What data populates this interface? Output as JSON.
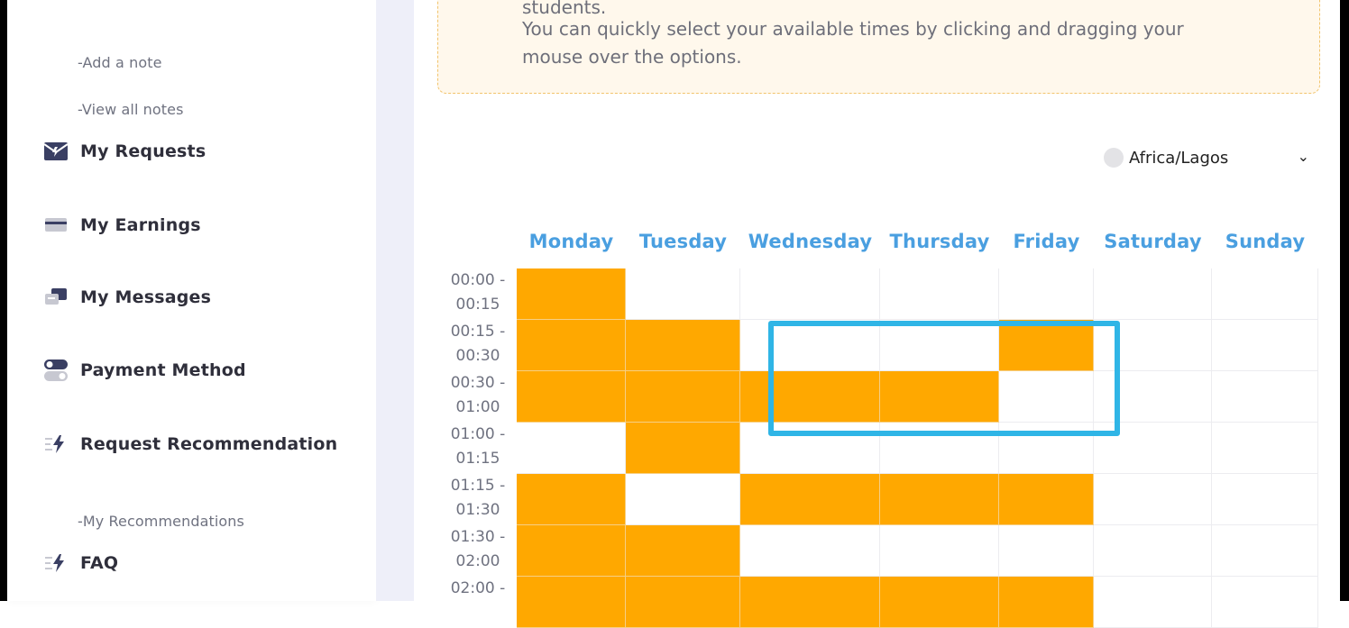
{
  "sidebar": {
    "sub_links": [
      {
        "label": "-Add a note"
      },
      {
        "label": "-View all notes"
      },
      {
        "label": "-My Recommendations"
      }
    ],
    "items": [
      {
        "label": "My Requests",
        "icon": "envelope-icon"
      },
      {
        "label": "My Earnings",
        "icon": "card-icon"
      },
      {
        "label": "My Messages",
        "icon": "chat-icon"
      },
      {
        "label": "Payment Method",
        "icon": "toggle-icon"
      },
      {
        "label": "Request Recommendation",
        "icon": "bolt-icon"
      },
      {
        "label": "FAQ",
        "icon": "bolt-icon"
      }
    ]
  },
  "notice": {
    "line1": "students.",
    "line2": "You can quickly select your available times by clicking and dragging your",
    "line3": "mouse over the options."
  },
  "timezone": {
    "value": "Africa/Lagos"
  },
  "schedule": {
    "days": [
      "Monday",
      "Tuesday",
      "Wednesday",
      "Thursday",
      "Friday",
      "Saturday",
      "Sunday"
    ],
    "slots": [
      {
        "label1": "00:00 -",
        "label2": "00:15",
        "on": [
          true,
          false,
          false,
          false,
          false,
          false,
          false
        ]
      },
      {
        "label1": "00:15 -",
        "label2": "00:30",
        "on": [
          true,
          true,
          false,
          false,
          true,
          false,
          false
        ]
      },
      {
        "label1": "00:30 -",
        "label2": "01:00",
        "on": [
          true,
          true,
          true,
          true,
          false,
          false,
          false
        ]
      },
      {
        "label1": "01:00 -",
        "label2": "01:15",
        "on": [
          false,
          true,
          false,
          false,
          false,
          false,
          false
        ]
      },
      {
        "label1": "01:15 -",
        "label2": "01:30",
        "on": [
          true,
          false,
          true,
          true,
          true,
          false,
          false
        ]
      },
      {
        "label1": "01:30 -",
        "label2": "02:00",
        "on": [
          true,
          true,
          false,
          false,
          false,
          false,
          false
        ]
      },
      {
        "label1": "02:00 -",
        "label2": "",
        "on": [
          true,
          true,
          true,
          true,
          true,
          false,
          false
        ]
      }
    ],
    "colors": {
      "selected": "#ffa800",
      "header": "#4a9fe0",
      "highlight": "#2fb5e6"
    }
  }
}
